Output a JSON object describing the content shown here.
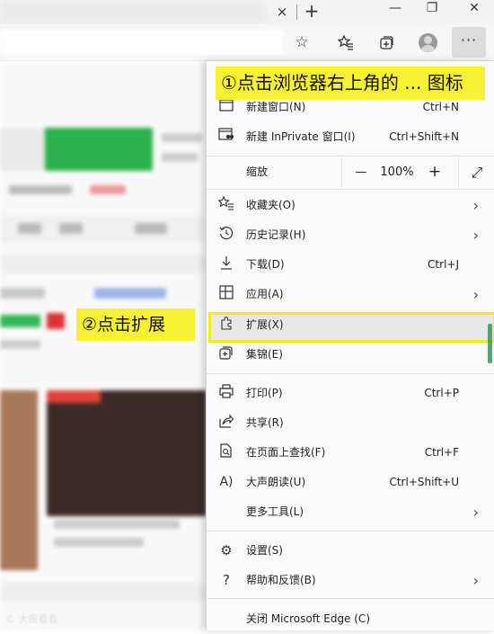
{
  "chrome": {
    "tab_close": "×",
    "new_tab": "+",
    "window": {
      "minimize": "—",
      "restore": "❐",
      "close": "✕"
    },
    "toolbar_icons": [
      "favorite-star-icon",
      "favorites-list-icon",
      "collections-icon",
      "profile-avatar",
      "more-options-icon"
    ],
    "more_label": "···"
  },
  "menu": {
    "new_window": {
      "label": "新建窗口(N)",
      "shortcut": "Ctrl+N"
    },
    "new_inprivate": {
      "label": "新建 InPrivate 窗口(I)",
      "shortcut": "Ctrl+Shift+N"
    },
    "zoom": {
      "label": "缩放",
      "minus": "—",
      "value": "100%",
      "plus": "+",
      "fullscreen": "⤢"
    },
    "favorites": {
      "label": "收藏夹(O)"
    },
    "history": {
      "label": "历史记录(H)"
    },
    "downloads": {
      "label": "下载(D)",
      "shortcut": "Ctrl+J"
    },
    "apps": {
      "label": "应用(A)"
    },
    "extensions": {
      "label": "扩展(X)"
    },
    "collections": {
      "label": "集锦(E)"
    },
    "print": {
      "label": "打印(P)",
      "shortcut": "Ctrl+P"
    },
    "share": {
      "label": "共享(R)"
    },
    "find": {
      "label": "在页面上查找(F)",
      "shortcut": "Ctrl+F"
    },
    "read_aloud": {
      "label": "大声朗读(U)",
      "shortcut": "Ctrl+Shift+U"
    },
    "more_tools": {
      "label": "更多工具(L)"
    },
    "settings": {
      "label": "设置(S)"
    },
    "help": {
      "label": "帮助和反馈(B)"
    },
    "close_edge": {
      "label": "关闭 Microsoft Edge (C)"
    }
  },
  "annotations": {
    "step1": "①点击浏览器右上角的 ... 图标",
    "step2": "②点击扩展"
  },
  "watermark": "© 大眼看看",
  "colors": {
    "callout": "#f7f134",
    "highlight_border": "#f5ec1e",
    "scroll_accent": "#2f9a5b"
  }
}
